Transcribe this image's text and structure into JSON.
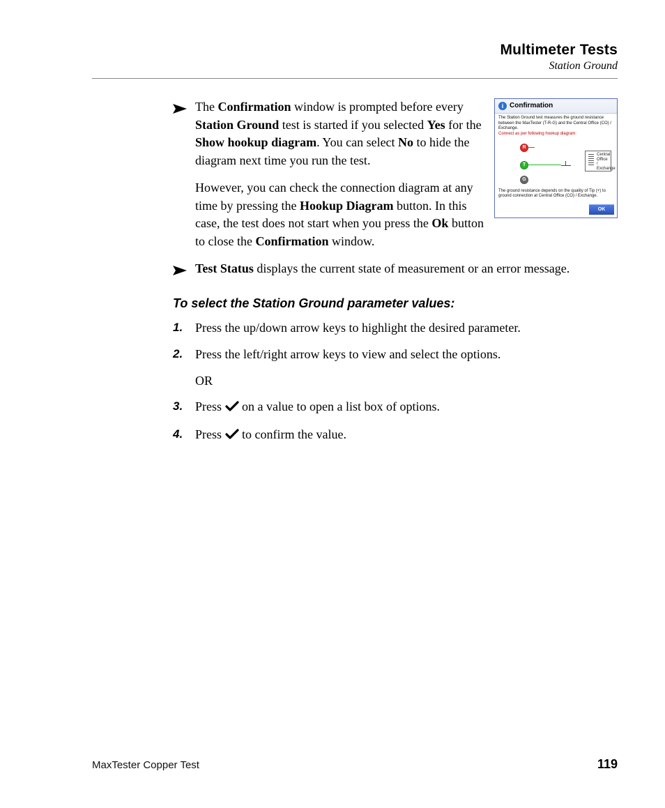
{
  "header": {
    "title": "Multimeter Tests",
    "subtitle": "Station Ground"
  },
  "kw": {
    "confirmation": "Confirmation",
    "station_ground": "Station Ground",
    "yes": "Yes",
    "show_hookup": "Show hookup diagram",
    "no": "No",
    "hookup_diagram": "Hookup Diagram",
    "ok": "Ok",
    "test_status": "Test Status"
  },
  "para": {
    "b1a": "The ",
    "b1b": " window is prompted before every ",
    "b1c": " test is started if you selected ",
    "b1d": " for the ",
    "b1e": ". You can select ",
    "b1f": " to hide the diagram next time you run the test.",
    "b1g": "However, you can check the connection diagram at any time by pressing the ",
    "b1h": " button. In this case, the test does not start when you press the ",
    "b1i": " button to close the ",
    "b1j": " window.",
    "b2a": " displays the current state of measurement or an error message."
  },
  "subheading": "To select the Station Ground parameter values:",
  "steps": {
    "n1": "1.",
    "s1": "Press the up/down arrow keys to highlight the desired parameter.",
    "n2": "2.",
    "s2": "Press the left/right arrow keys to view and select the options.",
    "or": "OR",
    "n3": "3.",
    "s3a": "Press ",
    "s3b": " on a value to open a list box of options.",
    "n4": "4.",
    "s4a": "Press ",
    "s4b": " to confirm the value."
  },
  "dialog": {
    "title": "Confirmation",
    "line1": "The Station Ground test measures the ground resistance between the MaxTester (T-R-G) and the Central Office (CO) / Exchange.",
    "line2": "Connect as per following hookup diagram:",
    "node_r": "R",
    "node_t": "T",
    "node_g": "G",
    "co": "Central Office / Exchange",
    "footer": "The ground resistance depends on the quality of Tip (+) to ground connection at Central Office (CO) / Exchange.",
    "ok": "OK"
  },
  "footer": {
    "product": "MaxTester Copper Test",
    "page": "119"
  }
}
